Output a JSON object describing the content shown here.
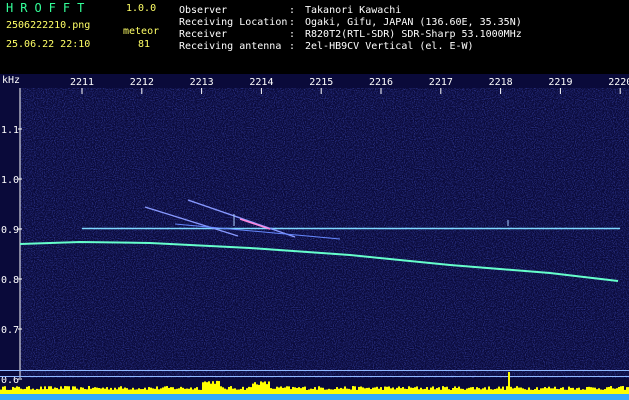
{
  "header": {
    "app_title": "HROFFT",
    "version": "1.0.0",
    "filename": "2506222210.png",
    "datetime": "25.06.22 22:10",
    "mode_label": "meteor",
    "count": "81"
  },
  "info": [
    {
      "label": "Observer",
      "value": "Takanori Kawachi"
    },
    {
      "label": "Receiving Location",
      "value": "Ogaki, Gifu, JAPAN (136.60E, 35.35N)"
    },
    {
      "label": "Receiver",
      "value": "R820T2(RTL-SDR) SDR-Sharp 53.1000MHz"
    },
    {
      "label": "Receiving antenna",
      "value": "2el-HB9CV Vertical (el. E-W)"
    }
  ],
  "chart_data": {
    "type": "heatmap",
    "y_unit": "kHz",
    "x_ticks": [
      "2211",
      "2212",
      "2213",
      "2214",
      "2215",
      "2216",
      "2217",
      "2218",
      "2219",
      "2220"
    ],
    "y_ticks": [
      "1.1",
      "1.0",
      "0.9",
      "0.8",
      "0.7",
      "0.6"
    ],
    "colors": {
      "background": "#0a0a3a",
      "grid": "#333a80",
      "trace": "#66ffcc",
      "meteor": "#8899ff",
      "carrier": "#7fd8ff",
      "level": "#ffff00"
    }
  }
}
